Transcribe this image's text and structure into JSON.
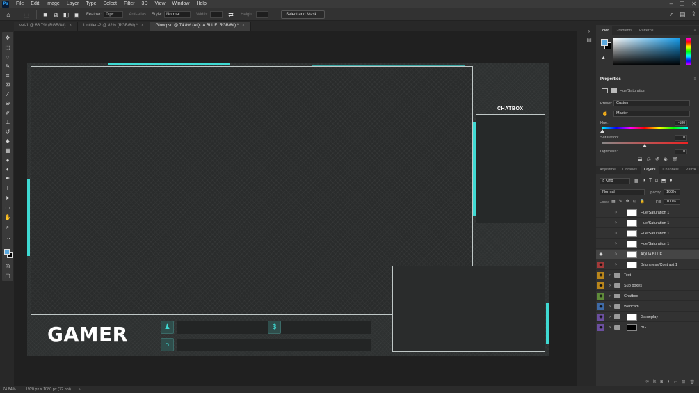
{
  "colors": {
    "accent": "#3fd9d2",
    "ps_blue": "#31a8ff",
    "panel_bg": "#323232",
    "workspace_bg": "#202020"
  },
  "app": {
    "logo": "Ps",
    "menus": [
      "File",
      "Edit",
      "Image",
      "Layer",
      "Type",
      "Select",
      "Filter",
      "3D",
      "View",
      "Window",
      "Help"
    ],
    "window_controls": [
      "–",
      "❐",
      "✕"
    ]
  },
  "options": {
    "feather_label": "Feather:",
    "feather_value": "0 px",
    "antialias_label": "Anti-alias",
    "style_label": "Style:",
    "style_value": "Normal",
    "width_label": "Width:",
    "height_label": "Height:",
    "select_mask": "Select and Mask..."
  },
  "tabs": [
    {
      "label": "vel-1 @ 66.7% (RGB/8#)",
      "active": false
    },
    {
      "label": "Untitled-2 @ 82% (RGB/8#) *",
      "active": false
    },
    {
      "label": "Glow.psd @ 74.8% (AQUA BLUE, RGB/8#) *",
      "active": true
    }
  ],
  "canvas": {
    "chatbox_title": "CHATBOX",
    "gamer_logo": "GAMER"
  },
  "color_panel": {
    "tabs": [
      "Color",
      "Gradients",
      "Patterns"
    ]
  },
  "properties": {
    "title": "Properties",
    "adjustment": "Hue/Saturation",
    "preset_label": "Preset:",
    "preset_value": "Custom",
    "channel_value": "Master",
    "hue_label": "Hue:",
    "hue_value": "-180",
    "saturation_label": "Saturation:",
    "saturation_value": "0",
    "lightness_label": "Lightness:",
    "lightness_value": "0"
  },
  "layers_panel": {
    "tabs": [
      "Adjustme",
      "Libraries",
      "Layers",
      "Channels",
      "Paths"
    ],
    "kind_label": "Kind",
    "blend_mode": "Normal",
    "opacity_label": "Opacity:",
    "opacity_value": "100%",
    "lock_label": "Lock:",
    "fill_label": "Fill:",
    "fill_value": "100%",
    "layers": [
      {
        "name": "Hue/Saturation 1",
        "type": "adjustment",
        "visible": false,
        "eye_color": ""
      },
      {
        "name": "Hue/Saturation 1",
        "type": "adjustment",
        "visible": false,
        "eye_color": ""
      },
      {
        "name": "Hue/Saturation 1",
        "type": "adjustment",
        "visible": false,
        "eye_color": ""
      },
      {
        "name": "Hue/Saturation 1",
        "type": "adjustment",
        "visible": false,
        "eye_color": ""
      },
      {
        "name": "AQUA BLUE",
        "type": "adjustment",
        "visible": true,
        "selected": true,
        "eye_color": "#3a3a3a"
      },
      {
        "name": "Brightness/Contrast 1",
        "type": "adjustment",
        "visible": true,
        "eye_color": "#a33a3a"
      },
      {
        "name": "Text",
        "type": "folder",
        "visible": true,
        "eye_color": "#b9861c"
      },
      {
        "name": "Sub boxes",
        "type": "folder",
        "visible": true,
        "eye_color": "#b9861c"
      },
      {
        "name": "Chatbox",
        "type": "folder",
        "visible": true,
        "eye_color": "#5f8b3a"
      },
      {
        "name": "Webcam",
        "type": "folder",
        "visible": true,
        "eye_color": "#3f6aa6"
      },
      {
        "name": "Gameplay",
        "type": "folder-thumb",
        "visible": true,
        "eye_color": "#6b4f9e"
      },
      {
        "name": "BG",
        "type": "folder-thumb-dark",
        "visible": true,
        "eye_color": "#6b4f9e"
      }
    ]
  },
  "status": {
    "zoom": "74.84%",
    "doc_info": "1920 px x 1080 px (72 ppi)"
  }
}
